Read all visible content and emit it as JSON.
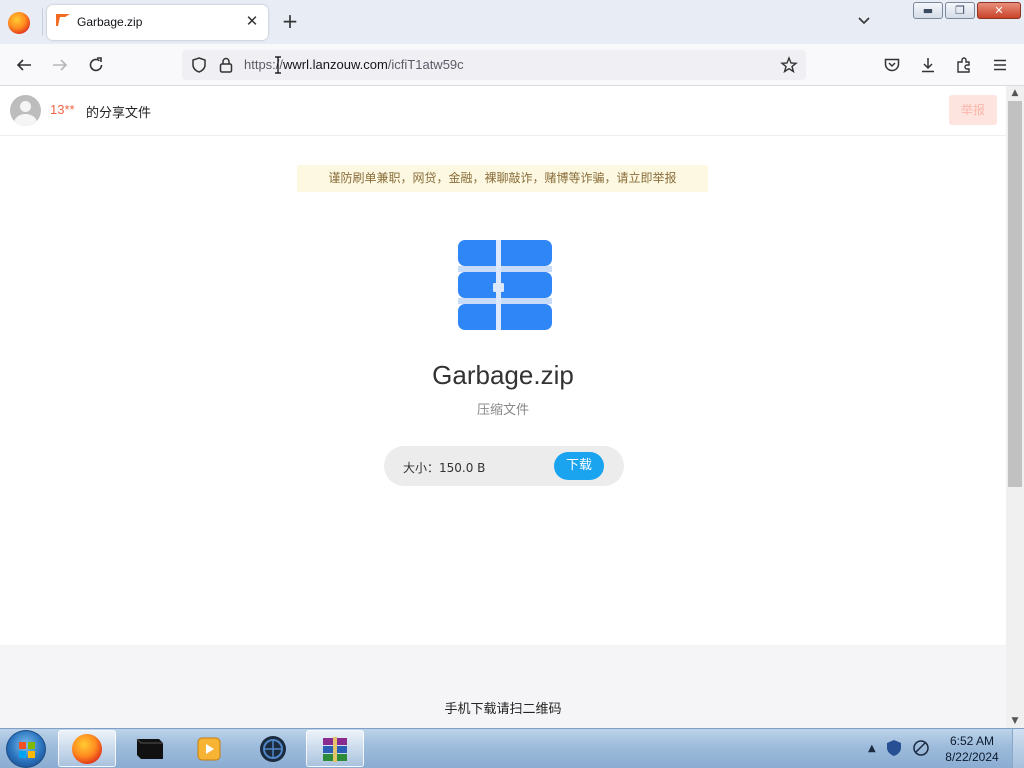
{
  "browser": {
    "tab": {
      "title": "Garbage.zip",
      "close": "✕"
    },
    "new_tab": "+",
    "url": {
      "scheme": "https://",
      "host": "wwrl.lanzouw.com",
      "path": "/icfiT1atw59c"
    },
    "window_buttons": {
      "minimize": "▬",
      "maximize": "❐",
      "close": "✕"
    }
  },
  "page": {
    "uploader": "13**",
    "share_label": "的分享文件",
    "report_button": "举报",
    "notice": "谨防刷单兼职，网贷，金融，裸聊敲诈，赌博等诈骗，请立即举报",
    "file": {
      "name": "Garbage.zip",
      "type": "压缩文件",
      "size_label": "大小：150.0 B",
      "download_button": "下载"
    },
    "footer_text": "手机下载请扫二维码"
  },
  "taskbar": {
    "clock": {
      "time": "6:52 AM",
      "date": "8/22/2024"
    },
    "items": [
      "firefox-icon",
      "terminal-icon",
      "media-player-icon",
      "app-globe-icon",
      "winrar-icon"
    ]
  },
  "colors": {
    "accent": "#1aa4f0",
    "uploader": "#f06548",
    "notice_bg": "#fcf8e1"
  }
}
